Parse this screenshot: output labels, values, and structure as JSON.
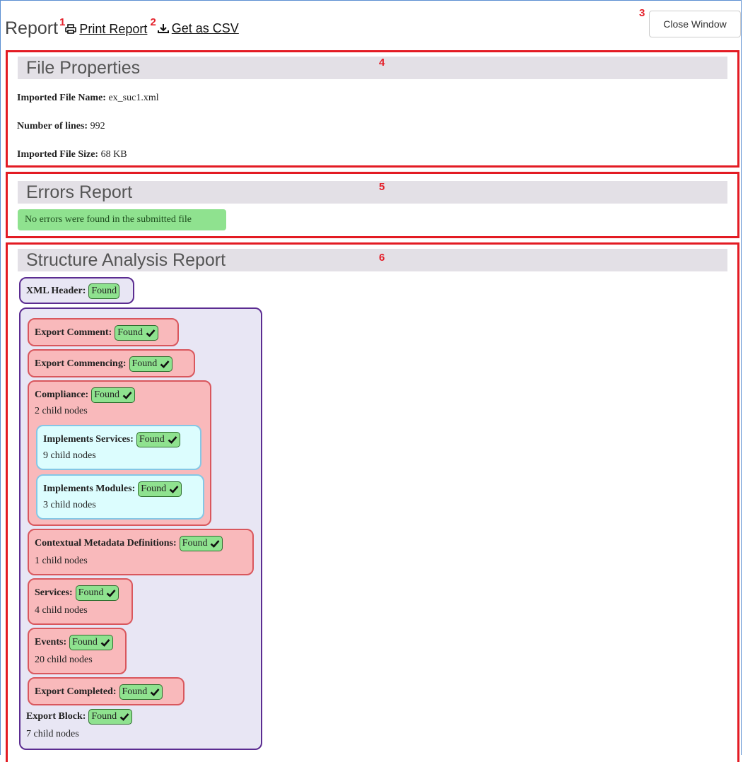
{
  "header": {
    "title": "Report",
    "print_label": "Print Report",
    "csv_label": "Get as CSV",
    "close_label": "Close Window"
  },
  "markers": [
    "1",
    "2",
    "3",
    "4",
    "5",
    "6"
  ],
  "file_properties": {
    "heading": "File Properties",
    "rows": [
      {
        "label": "Imported File Name:",
        "value": "ex_suc1.xml"
      },
      {
        "label": "Number of lines:",
        "value": "992"
      },
      {
        "label": "Imported File Size:",
        "value": "68 KB"
      }
    ]
  },
  "errors_report": {
    "heading": "Errors Report",
    "message": "No errors were found in the submitted file"
  },
  "structure": {
    "heading": "Structure Analysis Report",
    "nodes": [
      {
        "label": "XML Header:",
        "status": "Found"
      },
      {
        "label": "Export Comment:",
        "status": "Found"
      },
      {
        "label": "Export Commencing:",
        "status": "Found"
      },
      {
        "label": "Compliance:",
        "status": "Found",
        "children": "2 child nodes"
      },
      {
        "label": "Implements Services:",
        "status": "Found",
        "children": "9 child nodes"
      },
      {
        "label": "Implements Modules:",
        "status": "Found",
        "children": "3 child nodes"
      },
      {
        "label": "Contextual Metadata Definitions:",
        "status": "Found",
        "children": "1 child nodes"
      },
      {
        "label": "Services:",
        "status": "Found",
        "children": "4 child nodes"
      },
      {
        "label": "Events:",
        "status": "Found",
        "children": "20 child nodes"
      },
      {
        "label": "Export Completed:",
        "status": "Found"
      },
      {
        "label": "Export Block:",
        "status": "Found",
        "children": "7 child nodes"
      }
    ]
  },
  "colors": {
    "highlight": "#e31b23",
    "found_badge": "#8fe28f",
    "node_purple": "#5b2c91",
    "node_red": "#f9b9bb",
    "node_cyan": "#dcfdfe"
  }
}
